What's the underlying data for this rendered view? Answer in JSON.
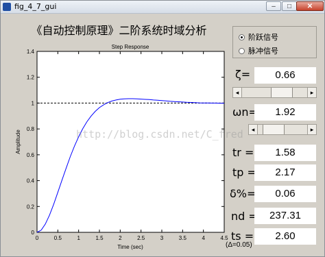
{
  "window": {
    "title": "fig_4_7_gui",
    "minimize_label": "–",
    "maximize_label": "□",
    "close_label": "✕"
  },
  "heading": "《自动控制原理》二阶系统时域分析",
  "watermark": "http://blog.csdn.net/C_fred",
  "radio": {
    "options": [
      {
        "label": "阶跃信号",
        "selected": true
      },
      {
        "label": "脉冲信号",
        "selected": false
      }
    ]
  },
  "params": {
    "zeta_label": "ζ=",
    "zeta_value": "0.66",
    "zeta_slider_fraction": 0.66,
    "wn_label": "ωn=",
    "wn_value": "1.92",
    "wn_slider_fraction": 0.19
  },
  "results": [
    {
      "label": "tr =",
      "value": "1.58"
    },
    {
      "label": "tp =",
      "value": "2.17"
    },
    {
      "label": "δ%=",
      "value": "0.06"
    },
    {
      "label": "nd =",
      "value": "237.31"
    },
    {
      "label": "ts =",
      "value": "2.60"
    }
  ],
  "footnote": "(Δ=0.05)",
  "chart_data": {
    "type": "line",
    "title": "Step Response",
    "xlabel": "Time (sec)",
    "ylabel": "Amplitude",
    "xlim": [
      0,
      4.5
    ],
    "ylim": [
      0,
      1.4
    ],
    "xticks": [
      "0",
      "0.5",
      "1",
      "1.5",
      "2",
      "2.5",
      "3",
      "3.5",
      "4",
      "4.5"
    ],
    "yticks": [
      "0",
      "0.2",
      "0.4",
      "0.6",
      "0.8",
      "1",
      "1.2",
      "1.4"
    ],
    "reference_line": 1,
    "zeta": 0.66,
    "wn": 1.92,
    "series": [
      {
        "color": "#0000ff",
        "x": [
          0,
          0.1,
          0.2,
          0.3,
          0.4,
          0.5,
          0.6,
          0.7,
          0.8,
          0.9,
          1.0,
          1.1,
          1.2,
          1.3,
          1.4,
          1.5,
          1.6,
          1.7,
          1.8,
          1.9,
          2.0,
          2.1,
          2.2,
          2.3,
          2.4,
          2.5,
          2.6,
          2.7,
          2.8,
          2.9,
          3.0,
          3.1,
          3.2,
          3.3,
          3.4,
          3.5,
          3.6,
          3.7,
          3.8,
          3.9,
          4.0,
          4.1,
          4.2,
          4.3,
          4.4,
          4.5
        ],
        "y": [
          0.0,
          0.017,
          0.064,
          0.133,
          0.217,
          0.309,
          0.404,
          0.497,
          0.586,
          0.667,
          0.739,
          0.802,
          0.856,
          0.9,
          0.936,
          0.965,
          0.987,
          1.004,
          1.016,
          1.024,
          1.03,
          1.033,
          1.034,
          1.034,
          1.033,
          1.031,
          1.029,
          1.027,
          1.024,
          1.022,
          1.019,
          1.017,
          1.014,
          1.012,
          1.01,
          1.008,
          1.006,
          1.005,
          1.004,
          1.002,
          1.001,
          1.001,
          1.0,
          1.0,
          0.999,
          0.999
        ]
      }
    ]
  }
}
